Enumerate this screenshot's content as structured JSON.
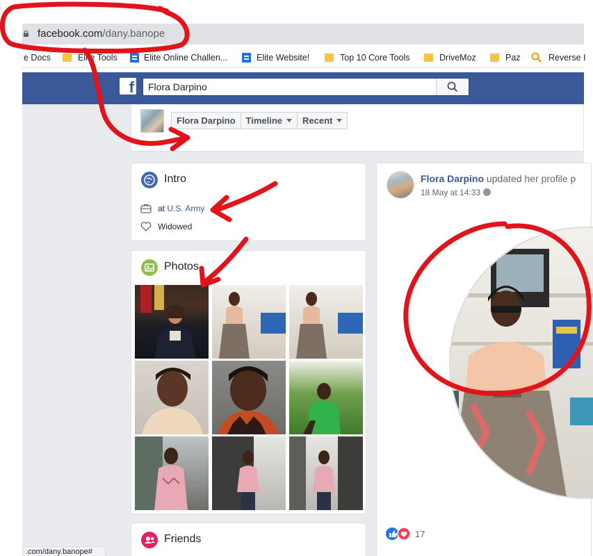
{
  "browser": {
    "url_domain": "facebook.com",
    "url_path": "/dany.banope",
    "bookmarks": [
      "e Docs",
      "Elite Tools",
      "Elite Online Challen...",
      "Elite Website!",
      "Top 10 Core Tools",
      "DriveMoz",
      "Paz",
      "Reverse I"
    ],
    "status_url": ".com/dany.banope#"
  },
  "facebook": {
    "search_value": "Flora Darpino",
    "brand_color": "#3b5998"
  },
  "profile_nav": {
    "name": "Flora Darpino",
    "timeline_label": "Timeline",
    "recent_label": "Recent"
  },
  "intro": {
    "title": "Intro",
    "work_prefix": "at",
    "work_link": "U.S. Army",
    "relationship": "Widowed"
  },
  "photos": {
    "title": "Photos",
    "items": [
      "army-officer",
      "woman-in-shop",
      "woman-in-shop",
      "woman-selfie",
      "woman-selfie",
      "woman-green-top",
      "woman-pink-top",
      "woman-pink-top",
      "woman-pink-top"
    ]
  },
  "friends": {
    "title": "Friends"
  },
  "post": {
    "author": "Flora Darpino",
    "action": "updated her profile p",
    "date": "18 May at 14:33",
    "reaction_count": "17"
  },
  "annotation_color": "#e0141a"
}
